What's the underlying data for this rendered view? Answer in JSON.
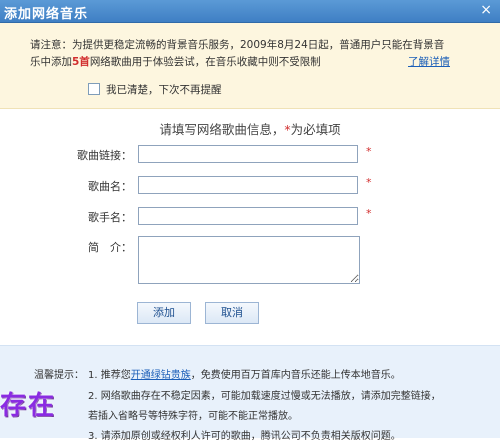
{
  "window": {
    "title": "添加网络音乐",
    "close_glyph": "×"
  },
  "notice": {
    "line1": "请注意：为提供更稳定流畅的背景音乐服务，2009年8月24日起，普通用户只能在背景音",
    "line2_a": "乐中添加",
    "line2_highlight": "5首",
    "line2_b": "网络歌曲用于体验尝试，在音乐收藏中则不受限制",
    "learn_more": "了解详情",
    "checkbox_label": "我已清楚，下次不再提醒",
    "checkbox_checked": false
  },
  "form": {
    "title_a": "请填写网络歌曲信息，",
    "title_star": "*",
    "title_b": "为必填项",
    "fields": [
      {
        "label": "歌曲链接：",
        "value": "",
        "required": "*"
      },
      {
        "label": "歌曲名：",
        "value": "",
        "required": "*"
      },
      {
        "label": "歌手名：",
        "value": "",
        "required": "*"
      }
    ],
    "intro_label": "简　介：",
    "intro_value": "",
    "add_button": "添加",
    "cancel_button": "取消"
  },
  "tips": {
    "label": "温馨提示：",
    "tip1_a": "1. 推荐您",
    "tip1_link": "开通绿钻贵族",
    "tip1_b": "，免费使用百万首库内音乐还能上传本地音乐。",
    "tip2": "2. 网络歌曲存在不稳定因素，可能加载速度过慢或无法播放，请添加完整链接，",
    "tip2_cont": "若插入省略号等特殊字符，可能不能正常播放。",
    "tip3": "3. 请添加原创或经权利人许可的歌曲，腾讯公司不负责相关版权问题。",
    "overlay_text": "存在"
  },
  "colors": {
    "titlebar": "#4a8bd0",
    "notice_bg": "#fdf6df",
    "required": "#d12d2d",
    "link": "#1c5fb8",
    "tips_bg": "#e8f1fb"
  }
}
